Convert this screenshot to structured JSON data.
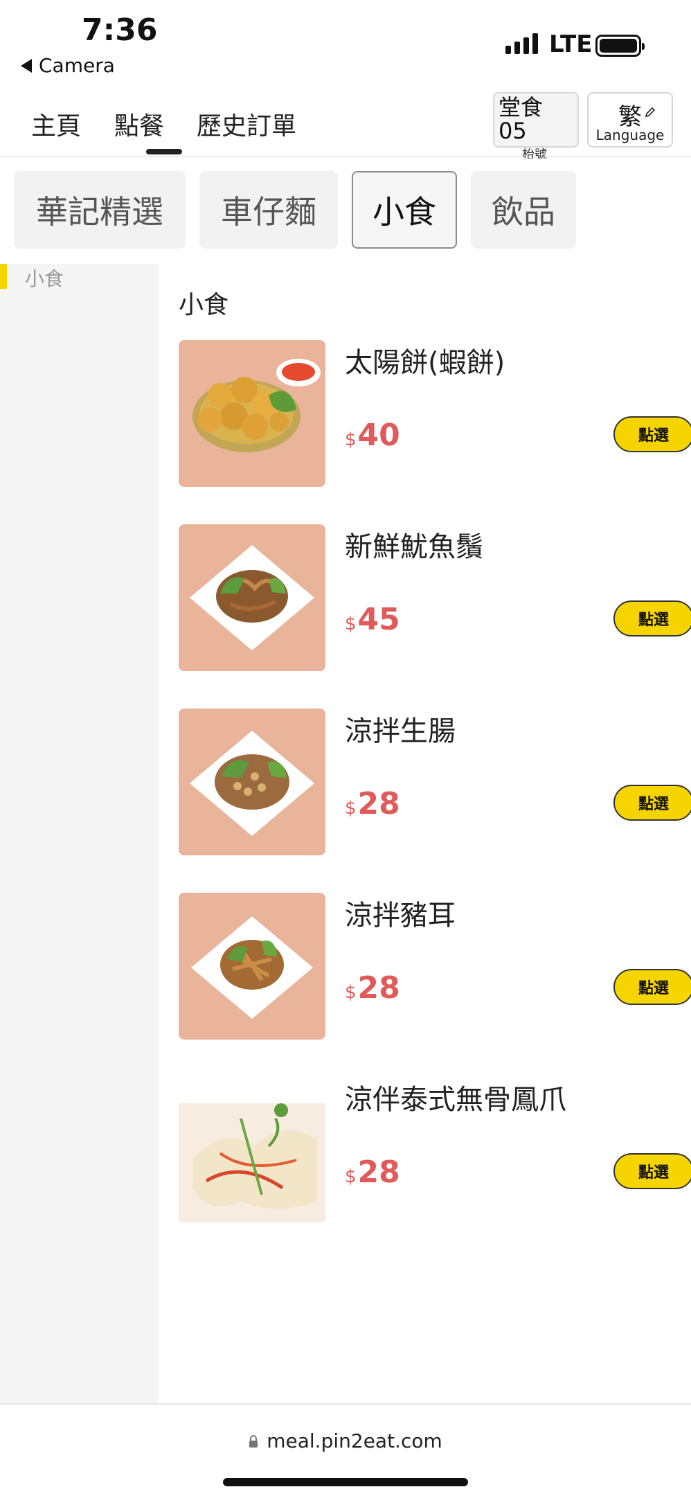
{
  "status_bar": {
    "time": "7:36",
    "back_label": "Camera",
    "network": "LTE",
    "battery_level": 1.0
  },
  "top_nav": {
    "tabs": [
      {
        "label": "主頁",
        "active": false
      },
      {
        "label": "點餐",
        "active": true
      },
      {
        "label": "歷史訂單",
        "active": false
      }
    ],
    "dine_in": {
      "title": "堂食",
      "number": "05",
      "subtitle": "枱號"
    },
    "language": {
      "char": "繁",
      "label": "Language",
      "icon": "pencil-icon"
    }
  },
  "categories": [
    {
      "label": "華記精選",
      "active": false
    },
    {
      "label": "車仔麵",
      "active": false
    },
    {
      "label": "小食",
      "active": true
    },
    {
      "label": "飲品",
      "active": false
    }
  ],
  "sidebar": {
    "items": [
      {
        "label": "小食",
        "active": true
      }
    ]
  },
  "menu": {
    "section_title": "小食",
    "currency": "$",
    "select_label": "點選",
    "items": [
      {
        "name": "太陽餅(蝦餅)",
        "price": "40"
      },
      {
        "name": "新鮮魷魚鬚",
        "price": "45"
      },
      {
        "name": "涼拌生腸",
        "price": "28"
      },
      {
        "name": "涼拌豬耳",
        "price": "28"
      },
      {
        "name": "涼伴泰式無骨鳳爪",
        "price": "28"
      }
    ]
  },
  "url_bar": {
    "url": "meal.pin2eat.com",
    "icon": "lock-icon"
  },
  "colors": {
    "accent_yellow": "#f5d400",
    "price_red": "#e05a5a"
  }
}
